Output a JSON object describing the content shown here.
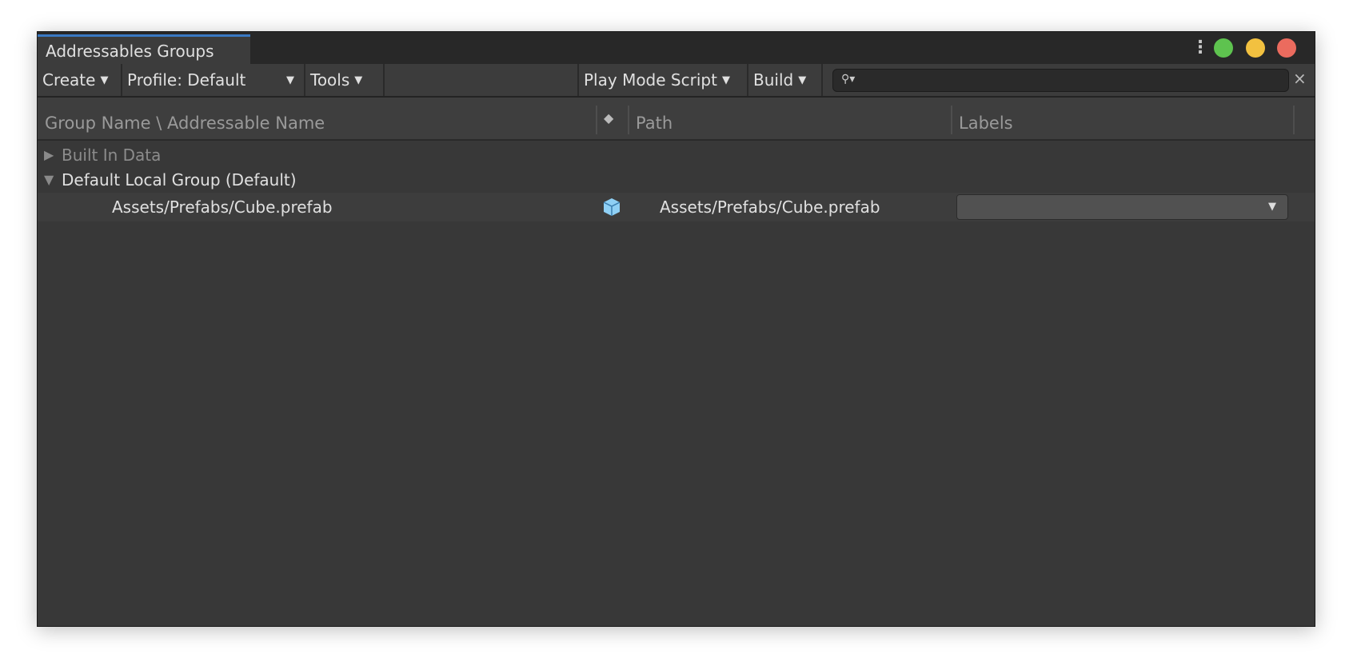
{
  "window": {
    "tab_title": "Addressables Groups",
    "colors": {
      "green": "#5ec34f",
      "yellow": "#f2c140",
      "red": "#eb6b5e",
      "accent": "#3a79c4"
    }
  },
  "toolbar": {
    "create": "Create",
    "profile": "Profile: Default",
    "tools": "Tools",
    "play_mode_script": "Play Mode Script",
    "build": "Build",
    "search_value": "",
    "clear": "×"
  },
  "header": {
    "group_name": "Group Name \\ Addressable Name",
    "path": "Path",
    "labels": "Labels"
  },
  "tree": {
    "groups": [
      {
        "name": "Built In Data",
        "expanded": false
      },
      {
        "name": "Default Local Group (Default)",
        "expanded": true
      }
    ],
    "entries": [
      {
        "name": "Assets/Prefabs/Cube.prefab",
        "path": "Assets/Prefabs/Cube.prefab",
        "labels": ""
      }
    ]
  }
}
